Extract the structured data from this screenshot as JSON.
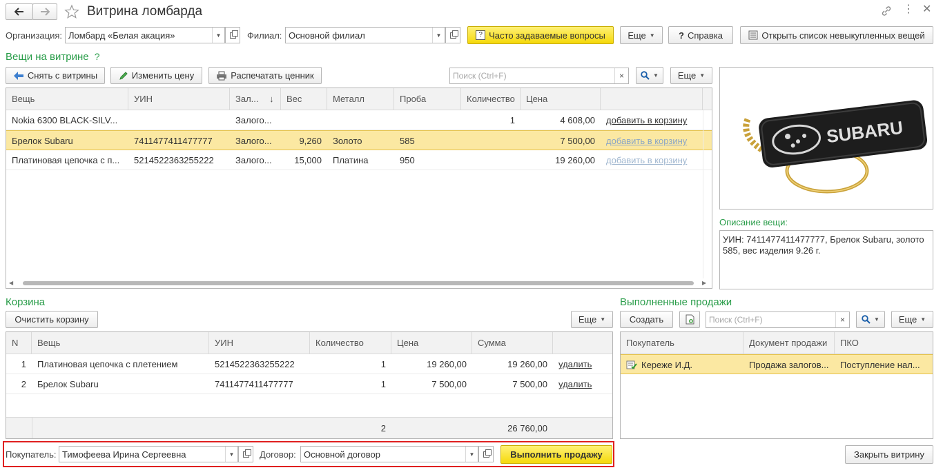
{
  "window": {
    "title": "Витрина ломбарда"
  },
  "top": {
    "org_label": "Организация:",
    "org_value": "Ломбард «Белая акация»",
    "branch_label": "Филиал:",
    "branch_value": "Основной филиал",
    "faq_label": "Часто задаваемые вопросы",
    "more_label": "Еще",
    "help_label": "Справка",
    "open_list_label": "Открыть список невыкупленных вещей"
  },
  "showcase": {
    "title": "Вещи на витрине",
    "help_mark": "?",
    "remove_label": "Снять с витрины",
    "change_price_label": "Изменить цену",
    "print_label": "Распечатать ценник",
    "search_placeholder": "Поиск (Ctrl+F)",
    "more_label": "Еще",
    "columns": [
      "Вещь",
      "УИН",
      "Зал...",
      "Вес",
      "Металл",
      "Проба",
      "Количество",
      "Цена"
    ],
    "sort_mark": "↓",
    "rows": [
      {
        "item": "Nokia 6300 BLACK-SILV...",
        "uin": "",
        "pledge": "Залого...",
        "weight": "",
        "metal": "",
        "probe": "",
        "qty": "1",
        "price": "4 608,00",
        "action": "добавить в корзину"
      },
      {
        "item": "Брелок Subaru",
        "uin": "7411477411477777",
        "pledge": "Залого...",
        "weight": "9,260",
        "metal": "Золото",
        "probe": "585",
        "qty": "",
        "price": "7 500,00",
        "action": "добавить в корзину"
      },
      {
        "item": "Платиновая цепочка с п...",
        "uin": "5214522363255222",
        "pledge": "Залого...",
        "weight": "15,000",
        "metal": "Платина",
        "probe": "950",
        "qty": "",
        "price": "19 260,00",
        "action": "добавить в корзину"
      }
    ]
  },
  "preview": {
    "brand_text": "SUBARU",
    "desc_label": "Описание вещи:",
    "desc_text": "УИН: 7411477411477777, Брелок Subaru, золото 585, вес изделия 9.26 г."
  },
  "cart": {
    "title": "Корзина",
    "clear_label": "Очистить корзину",
    "more_label": "Еще",
    "columns": [
      "N",
      "Вещь",
      "УИН",
      "Количество",
      "Цена",
      "Сумма"
    ],
    "rows": [
      {
        "n": "1",
        "item": "Платиновая цепочка с плетением",
        "uin": "5214522363255222",
        "qty": "1",
        "price": "19 260,00",
        "sum": "19 260,00",
        "action": "удалить"
      },
      {
        "n": "2",
        "item": "Брелок Subaru",
        "uin": "7411477411477777",
        "qty": "1",
        "price": "7 500,00",
        "sum": "7 500,00",
        "action": "удалить"
      }
    ],
    "total_qty": "2",
    "total_sum": "26 760,00"
  },
  "sales": {
    "title": "Выполненные продажи",
    "create_label": "Создать",
    "search_placeholder": "Поиск (Ctrl+F)",
    "more_label": "Еще",
    "columns": [
      "Покупатель",
      "Документ продажи",
      "ПКО"
    ],
    "rows": [
      {
        "buyer": "Кереже И.Д.",
        "doc": "Продажа залогов...",
        "pko": "Поступление нал..."
      }
    ]
  },
  "bottom": {
    "buyer_label": "Покупатель:",
    "buyer_value": "Тимофеева Ирина Сергеевна",
    "contract_label": "Договор:",
    "contract_value": "Основной договор",
    "execute_label": "Выполнить продажу",
    "close_label": "Закрыть витрину"
  },
  "colors": {
    "accent_green": "#2a9d4a",
    "highlight": "#fbe8a2",
    "button_yellow": "#f5d90a",
    "frame_red": "#e02020",
    "link": "#1b5faa"
  }
}
